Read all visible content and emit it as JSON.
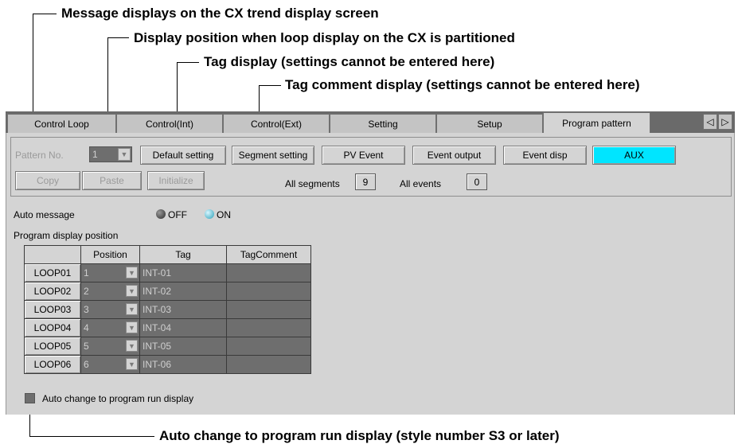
{
  "callouts": {
    "message": "Message displays on the CX trend display screen",
    "position": "Display position when loop display on the CX is partitioned",
    "tag": "Tag display (settings cannot be entered here)",
    "tag_comment": "Tag comment display (settings cannot be entered here)",
    "auto_change": "Auto change to program run display (style number S3 or later)"
  },
  "tabs": [
    {
      "label": "Control Loop",
      "active": false
    },
    {
      "label": "Control(Int)",
      "active": false
    },
    {
      "label": "Control(Ext)",
      "active": false
    },
    {
      "label": "Setting",
      "active": false
    },
    {
      "label": "Setup",
      "active": false
    },
    {
      "label": "Program pattern",
      "active": true
    }
  ],
  "tab_scroll": {
    "left": "◁",
    "right": "▷"
  },
  "toolbar": {
    "pattern_no_label": "Pattern No.",
    "pattern_no_value": "1",
    "default_setting": "Default setting",
    "segment_setting": "Segment setting",
    "pv_event": "PV Event",
    "event_output": "Event output",
    "event_disp": "Event disp",
    "aux": "AUX",
    "copy": "Copy",
    "paste": "Paste",
    "initialize": "Initialize",
    "all_segments_label": "All segments",
    "all_segments_value": "9",
    "all_events_label": "All events",
    "all_events_value": "0"
  },
  "auto_message": {
    "label": "Auto message",
    "off_label": "OFF",
    "on_label": "ON",
    "selected": "OFF"
  },
  "program_display_position_label": "Program display position",
  "table": {
    "headers": [
      "",
      "Position",
      "Tag",
      "TagComment"
    ],
    "rows": [
      {
        "loop": "LOOP01",
        "position": "1",
        "tag": "INT-01",
        "comment": ""
      },
      {
        "loop": "LOOP02",
        "position": "2",
        "tag": "INT-02",
        "comment": ""
      },
      {
        "loop": "LOOP03",
        "position": "3",
        "tag": "INT-03",
        "comment": ""
      },
      {
        "loop": "LOOP04",
        "position": "4",
        "tag": "INT-04",
        "comment": ""
      },
      {
        "loop": "LOOP05",
        "position": "5",
        "tag": "INT-05",
        "comment": ""
      },
      {
        "loop": "LOOP06",
        "position": "6",
        "tag": "INT-06",
        "comment": ""
      }
    ]
  },
  "auto_change_checkbox": {
    "label": "Auto change to program run display",
    "checked": false
  },
  "colors": {
    "aux_highlight": "#00e5ff",
    "panel": "#d4d4d4",
    "disabled_field": "#6e6e6e"
  }
}
